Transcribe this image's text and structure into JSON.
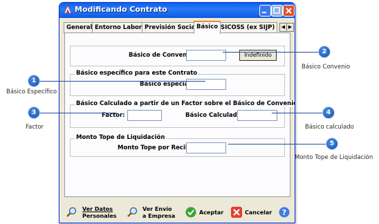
{
  "window": {
    "title": "Modificando Contrato"
  },
  "tabs": [
    "General",
    "Entorno Laboral",
    "Previsión Social",
    "Básico",
    "SICOSS (ex SIJP)"
  ],
  "active_tab": "Básico",
  "form": {
    "basico_convenio_label": "Básico de Convenio:",
    "indefinido": "Indefinido",
    "group1_title": "Básico específico para este Contrato",
    "basico_especial_label": "Básico especial:",
    "group2_title": "Básico Calculado a partir de un Factor sobre el Básico de Convenio",
    "factor_label": "Factor:",
    "basico_calculado_label": "Básico Calculado:",
    "group3_title": "Monto Tope de Liquidación",
    "monto_tope_label": "Monto Tope por Recibo:"
  },
  "footer": {
    "ver_datos_1": "Ver Datos",
    "ver_datos_2": "Personales",
    "ver_envio_1": "Ver Envío",
    "ver_envio_2": "a Empresa",
    "aceptar": "Aceptar",
    "cancelar": "Cancelar"
  },
  "callouts": {
    "c1_num": "1",
    "c1_label": "Básico Específico",
    "c2_num": "2",
    "c2_label": "Básico Convenio",
    "c3_num": "3",
    "c3_label": "Factor",
    "c4_num": "4",
    "c4_label": "Básico calculado",
    "c5_num": "5",
    "c5_label": "Monto Tope de Liquidación"
  },
  "colors": {
    "title_bar": "#0a5ff0",
    "callout": "#1450a8",
    "tab_highlight": "#e68b2c"
  }
}
